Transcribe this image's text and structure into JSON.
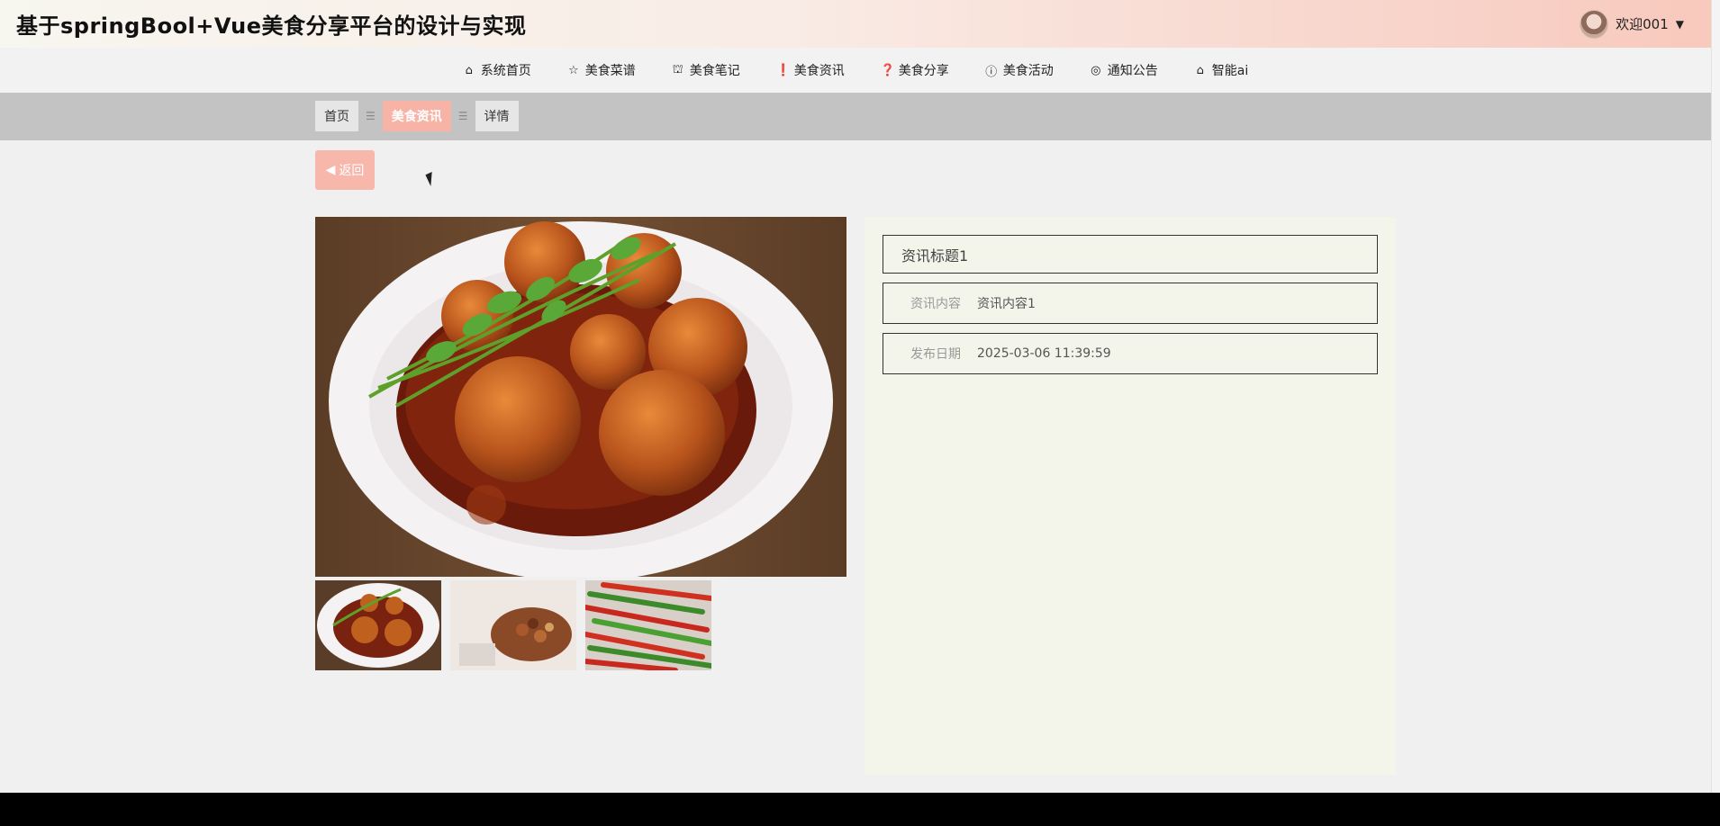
{
  "header": {
    "title": "基于springBool+Vue美食分享平台的设计与实现",
    "welcome": "欢迎001"
  },
  "nav": {
    "items": [
      {
        "label": "系统首页",
        "icon": "home-icon"
      },
      {
        "label": "美食菜谱",
        "icon": "star-icon"
      },
      {
        "label": "美食笔记",
        "icon": "bag-icon"
      },
      {
        "label": "美食资讯",
        "icon": "info-icon"
      },
      {
        "label": "美食分享",
        "icon": "help-icon"
      },
      {
        "label": "美食活动",
        "icon": "info-italic-icon"
      },
      {
        "label": "通知公告",
        "icon": "bell-icon"
      },
      {
        "label": "智能ai",
        "icon": "home-icon"
      }
    ]
  },
  "breadcrumb": {
    "home": "首页",
    "section": "美食资讯",
    "current": "详情"
  },
  "back_button": "返回",
  "detail": {
    "title": "资讯标题1",
    "content_label": "资讯内容",
    "content_value": "资讯内容1",
    "date_label": "发布日期",
    "date_value": "2025-03-06 11:39:59"
  },
  "colors": {
    "accent": "#f7b7ab",
    "panel_bg": "#f3f5ea",
    "footer": "#000000"
  }
}
